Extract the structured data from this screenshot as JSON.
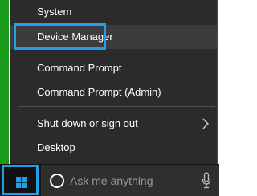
{
  "menu": {
    "items": [
      {
        "label": "System"
      },
      {
        "label": "Device Manager"
      },
      {
        "label": "Command Prompt"
      },
      {
        "label": "Command Prompt (Admin)"
      },
      {
        "label": "Shut down or sign out"
      },
      {
        "label": "Desktop"
      }
    ]
  },
  "taskbar": {
    "start_icon": "windows-logo-icon",
    "search_placeholder": "Ask me anything",
    "search_icon": "cortana-icon",
    "mic_icon": "microphone-icon"
  },
  "colors": {
    "accent": "#1ea0e6",
    "menu_bg": "#2b2b2b",
    "taskbar_bg": "#101010",
    "left_strip": "#1a9a1a"
  }
}
